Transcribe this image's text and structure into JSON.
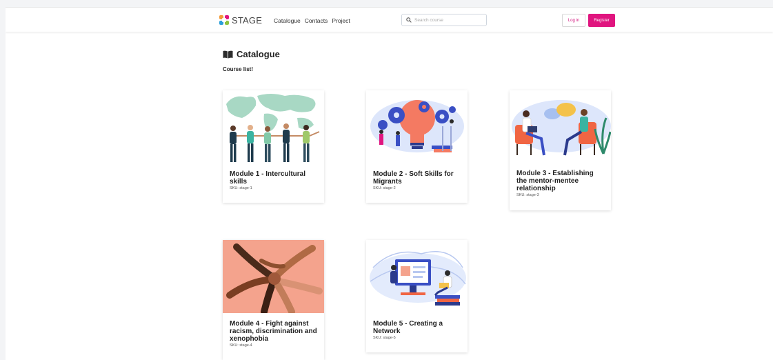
{
  "brand": {
    "name": "STAGE"
  },
  "nav": {
    "links": [
      "Catalogue",
      "Contacts",
      "Project"
    ]
  },
  "search": {
    "placeholder": "Search course"
  },
  "auth": {
    "login_label": "Log in",
    "register_label": "Register"
  },
  "page": {
    "title": "Catalogue",
    "subtitle": "Course list!"
  },
  "courses": [
    {
      "title": "Module 1 - Intercultural skills",
      "sku": "SKU: stage-1"
    },
    {
      "title": "Module 2 - Soft Skills for Migrants",
      "sku": "SKU: stage-2"
    },
    {
      "title": "Module 3 - Establishing the mentor-mentee relationship",
      "sku": "SKU: stage-3"
    },
    {
      "title": "Module 4 - Fight against racism, discrimination and xenophobia",
      "sku": "SKU: stage-4"
    },
    {
      "title": "Module 5 - Creating a Network",
      "sku": "SKU: stage-5"
    }
  ],
  "colors": {
    "accent": "#e0157f",
    "map": "#a8d8c4",
    "skin": "#f4a38d"
  }
}
